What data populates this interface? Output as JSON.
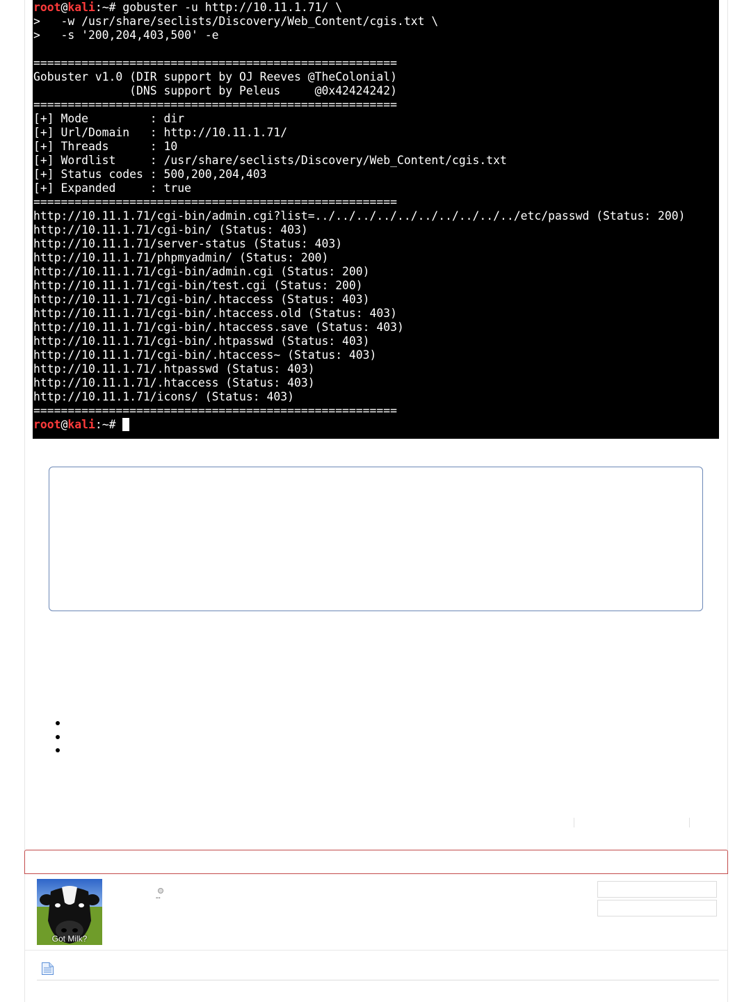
{
  "terminal": {
    "prompt_user": "root",
    "prompt_at": "@",
    "prompt_host": "kali",
    "prompt_suffix": ":~# ",
    "command_line1": "gobuster -u http://10.11.1.71/ \\",
    "command_line2": ">   -w /usr/share/seclists/Discovery/Web_Content/cgis.txt \\",
    "command_line3": ">   -s '200,204,403,500' -e",
    "separator": "=====================================================",
    "banner_line1": "Gobuster v1.0 (DIR support by OJ Reeves @TheColonial)",
    "banner_line2": "              (DNS support by Peleus     @0x42424242)",
    "config_lines": [
      "[+] Mode         : dir",
      "[+] Url/Domain   : http://10.11.1.71/",
      "[+] Threads      : 10",
      "[+] Wordlist     : /usr/share/seclists/Discovery/Web_Content/cgis.txt",
      "[+] Status codes : 500,200,204,403",
      "[+] Expanded     : true"
    ],
    "results": [
      "http://10.11.1.71/cgi-bin/admin.cgi?list=../../../../../../../../../../etc/passwd (Status: 200)",
      "http://10.11.1.71/cgi-bin/ (Status: 403)",
      "http://10.11.1.71/server-status (Status: 403)",
      "http://10.11.1.71/phpmyadmin/ (Status: 200)",
      "http://10.11.1.71/cgi-bin/admin.cgi (Status: 200)",
      "http://10.11.1.71/cgi-bin/test.cgi (Status: 200)",
      "http://10.11.1.71/cgi-bin/.htaccess (Status: 403)",
      "http://10.11.1.71/cgi-bin/.htaccess.old (Status: 403)",
      "http://10.11.1.71/cgi-bin/.htaccess.save (Status: 403)",
      "http://10.11.1.71/cgi-bin/.htpasswd (Status: 403)",
      "http://10.11.1.71/cgi-bin/.htaccess~ (Status: 403)",
      "http://10.11.1.71/.htpasswd (Status: 403)",
      "http://10.11.1.71/.htaccess (Status: 403)",
      "http://10.11.1.71/icons/ (Status: 403)"
    ]
  },
  "colors": {
    "terminal_bg": "#000000",
    "terminal_fg": "#ffffff",
    "prompt": "#ff3b3b",
    "quote_border": "#6b87b6",
    "post_header_border": "#c24a4a"
  },
  "bullet_list": {
    "count": 3
  },
  "author": {
    "avatar_caption": "Got Milk?",
    "status_icon": "offline-status-icon",
    "signature_text": "--"
  },
  "footer": {
    "icon": "document-icon"
  }
}
